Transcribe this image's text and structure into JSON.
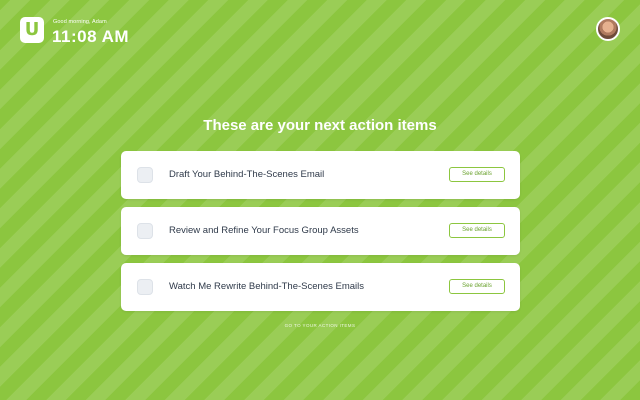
{
  "header": {
    "logo_letter": "U",
    "greeting": "Good morning, Adam",
    "time": "11:08 AM",
    "avatar_icon": "user-avatar"
  },
  "main": {
    "heading": "These are your next action items",
    "items": [
      {
        "label": "Draft Your Behind-The-Scenes Email",
        "button": "See details",
        "checked": false
      },
      {
        "label": "Review and Refine Your Focus Group Assets",
        "button": "See details",
        "checked": false
      },
      {
        "label": "Watch Me Rewrite Behind-The-Scenes Emails",
        "button": "See details",
        "checked": false
      }
    ],
    "footer_link": "GO TO YOUR ACTION ITEMS"
  },
  "colors": {
    "background": "#8cc63f",
    "accent": "#8cc63f",
    "text": "#2f3a4a"
  }
}
